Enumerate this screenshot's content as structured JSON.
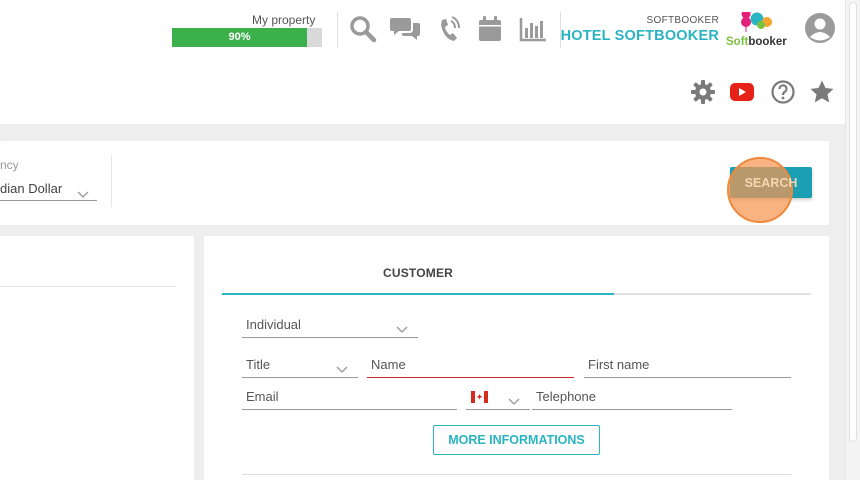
{
  "header": {
    "property_label": "My property",
    "progress_text": "90%",
    "progress_value": 0.9,
    "icons": [
      "search-icon",
      "chat-icon",
      "phone-icon",
      "calendar-icon",
      "chart-icon"
    ],
    "hotel_small": "SOFTBOOKER",
    "hotel_name": "HOTEL SOFTBOOKER",
    "logo_soft": "Soft",
    "logo_booker": "booker"
  },
  "toolbar": {
    "icons": [
      "gear-icon",
      "youtube-icon",
      "help-icon",
      "star-icon"
    ]
  },
  "search": {
    "currency_label": "ncy",
    "currency_value": "dian Dollar",
    "button_label": "SEARCH"
  },
  "customer": {
    "tab_label": "CUSTOMER",
    "type_value": "Individual",
    "title_placeholder": "Title",
    "name_placeholder": "Name",
    "firstname_placeholder": "First name",
    "email_placeholder": "Email",
    "telephone_placeholder": "Telephone",
    "more_button": "MORE INFORMATIONS"
  },
  "colors": {
    "accent": "#2ab4c2",
    "progress": "#3cb04a",
    "search_button": "#1a9fb4",
    "youtube": "#e62117",
    "error": "#c62828"
  }
}
